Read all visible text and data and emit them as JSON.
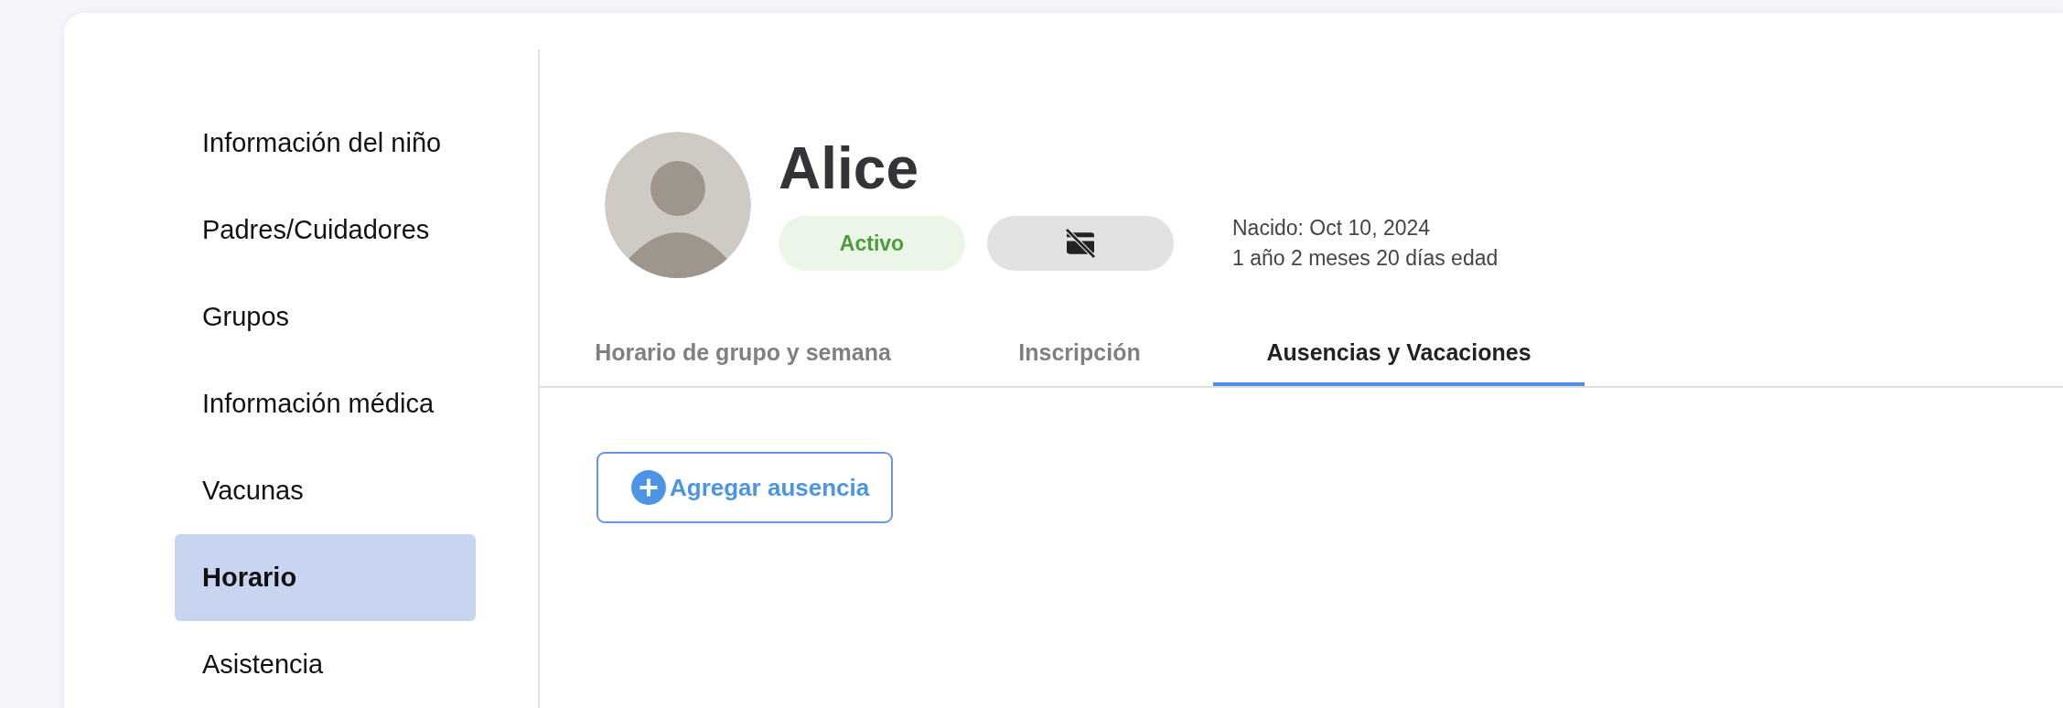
{
  "sidebar": {
    "items": [
      {
        "label": "Información del niño",
        "selected": false
      },
      {
        "label": "Padres/Cuidadores",
        "selected": false
      },
      {
        "label": "Grupos",
        "selected": false
      },
      {
        "label": "Información médica",
        "selected": false
      },
      {
        "label": "Vacunas",
        "selected": false
      },
      {
        "label": "Horario",
        "selected": true
      },
      {
        "label": "Asistencia",
        "selected": false
      }
    ]
  },
  "profile": {
    "name": "Alice",
    "status": "Activo",
    "born": "Nacido: Oct 10, 2024",
    "age": "1 año 2 meses 20 días edad"
  },
  "tabs": [
    {
      "label": "Horario de grupo y semana",
      "selected": false
    },
    {
      "label": "Inscripción",
      "selected": false
    },
    {
      "label": "Ausencias y Vacaciones",
      "selected": true
    }
  ],
  "add_button": {
    "label": "Agregar ausencia"
  }
}
